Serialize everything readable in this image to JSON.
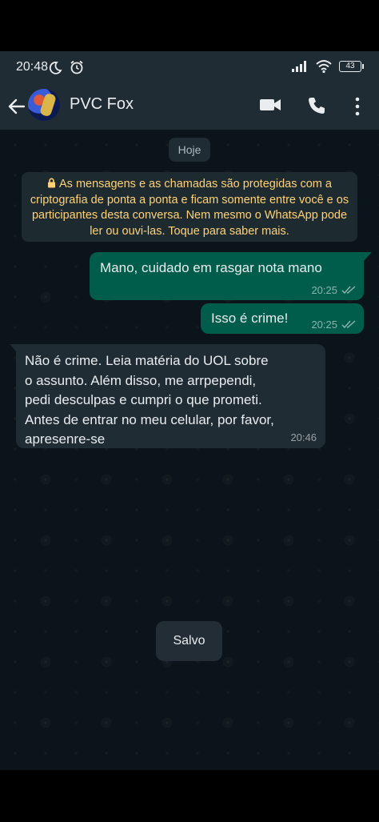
{
  "status_bar": {
    "time": "20:48",
    "battery": "43"
  },
  "header": {
    "contact_name": "PVC Fox"
  },
  "chat": {
    "date_label": "Hoje",
    "encryption_notice": "As mensagens e as chamadas são protegidas com a criptografia de ponta a ponta e ficam somente entre você e os participantes desta conversa. Nem mesmo o WhatsApp pode ler ou ouvi-las. Toque para saber mais.",
    "messages": [
      {
        "direction": "outgoing",
        "text": "Mano, cuidado em rasgar nota mano",
        "time": "20:25",
        "status": "read"
      },
      {
        "direction": "outgoing",
        "text": "Isso é crime!",
        "time": "20:25",
        "status": "read"
      },
      {
        "direction": "incoming",
        "text": "Não é crime. Leia  matéria do UOL sobre\no assunto. Além disso, me arrpependi,\npedi desculpas e cumpri o que prometi.\nAntes de entrar no meu celular, por favor,\napresenre-se",
        "time": "20:46"
      }
    ],
    "toast": "Salvo"
  },
  "colors": {
    "header_bg": "#1f2c34",
    "chat_bg": "#0b141a",
    "outgoing_bubble": "#005c4b",
    "incoming_bubble": "#1f2c34",
    "notice_text": "#ffd279"
  },
  "icons": [
    "moon-icon",
    "alarm-icon",
    "signal-icon",
    "wifi-icon",
    "battery-icon",
    "back-arrow-icon",
    "video-call-icon",
    "phone-icon",
    "more-vert-icon",
    "lock-icon",
    "double-check-icon"
  ]
}
